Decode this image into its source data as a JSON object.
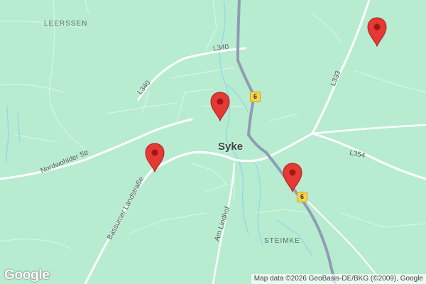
{
  "map": {
    "background_color": "#b7ecd0",
    "road_color": "#ffffff",
    "highway_color": "#8f9db3",
    "water_color": "#8ed7e8",
    "marker_color": "#e53935"
  },
  "labels": {
    "city": "Syke",
    "leerssen": "LEERSSEN",
    "steimke": "STEIMKE",
    "l340_top": "L340",
    "l340_left": "L340",
    "l333": "L333",
    "l354": "L354",
    "nordwohlder": "Nordwohlder Str.",
    "bassumer": "Bassumer Landstraße",
    "am_lindhof": "Am Lindhof"
  },
  "shields": {
    "route6_north": "6",
    "route6_south": "6"
  },
  "markers": [
    {
      "name": "marker-northeast"
    },
    {
      "name": "marker-center-north"
    },
    {
      "name": "marker-west"
    },
    {
      "name": "marker-south-east"
    }
  ],
  "footer": {
    "logo": "Google",
    "attribution": "Map data ©2026 GeoBasis-DE/BKG (©2009), Google"
  }
}
